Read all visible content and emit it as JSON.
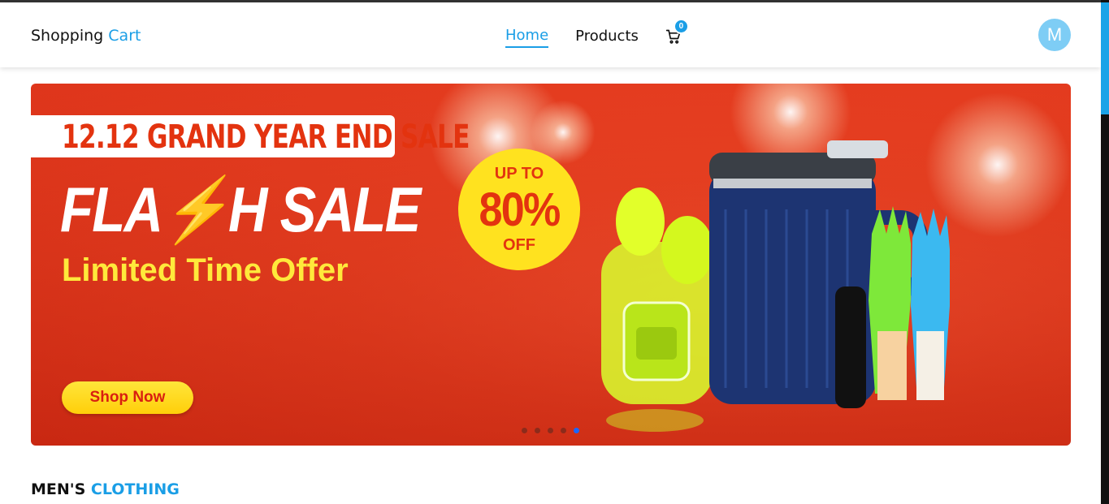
{
  "brand": {
    "name": "Shopping",
    "accent": "Cart"
  },
  "nav": {
    "home": "Home",
    "products": "Products"
  },
  "cart": {
    "icon": "cart-icon",
    "count": "0"
  },
  "user": {
    "initial": "M"
  },
  "banner": {
    "tagline": "12.12 GRAND YEAR END SALE",
    "headline": "FLA⚡H SALE",
    "offer": "Limited Time Offer",
    "badge_up": "UP TO",
    "badge_pct": "80%",
    "badge_off": "OFF",
    "shop_button": "Shop Now",
    "slides_total": 5,
    "active_slide": 5
  },
  "section": {
    "title": "MEN'S",
    "accent": "CLOTHING"
  },
  "colors": {
    "accent": "#1a9ee6",
    "banner_red": "#e73a1c",
    "badge_yellow": "#ffe21f"
  }
}
